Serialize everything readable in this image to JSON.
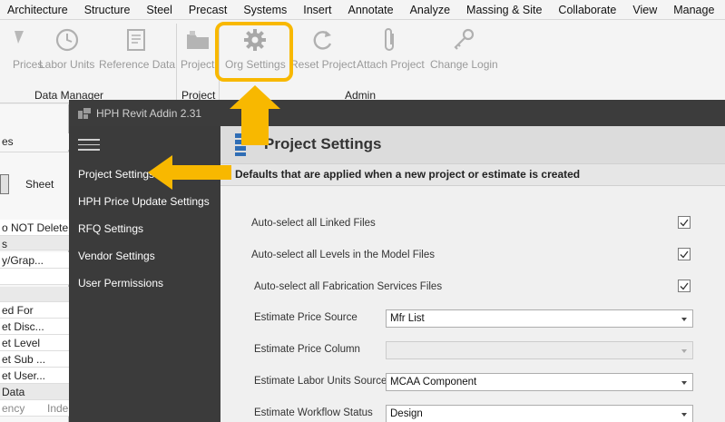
{
  "menubar": {
    "items": [
      "Architecture",
      "Structure",
      "Steel",
      "Precast",
      "Systems",
      "Insert",
      "Annotate",
      "Analyze",
      "Massing & Site",
      "Collaborate",
      "View",
      "Manage"
    ],
    "overflow": "˄"
  },
  "ribbon": {
    "buttons": [
      {
        "label": "Prices",
        "icon": "prices-icon"
      },
      {
        "label": "Labor Units",
        "icon": "clock-icon"
      },
      {
        "label": "Reference Data",
        "icon": "reference-data-icon"
      },
      {
        "label": "Project",
        "icon": "folder-icon"
      },
      {
        "label": "Org Settings",
        "icon": "gear-icon"
      },
      {
        "label": "Reset Project",
        "icon": "refresh-icon"
      },
      {
        "label": "Attach Project",
        "icon": "paperclip-icon"
      },
      {
        "label": "Change Login",
        "icon": "keys-icon"
      }
    ],
    "groups": [
      "Data Manager",
      "Project",
      "Admin"
    ]
  },
  "left_panel": {
    "rows": [
      "es",
      "Sheet",
      "o NOT Delete",
      "s",
      "y/Grap...",
      "",
      "ed For",
      "et Disc...",
      "et Level",
      "et Sub ...",
      "et User...",
      "Data",
      "ency",
      "Inde"
    ]
  },
  "dialog": {
    "title": "HPH Revit Addin 2.31",
    "nav": [
      "Project Settings",
      "HPH Price Update Settings",
      "RFQ Settings",
      "Vendor Settings",
      "User Permissions"
    ],
    "header_title": "Project Settings",
    "subheader": "Defaults that are applied when a new project or estimate is created",
    "checkbox_settings": [
      {
        "label": "Auto-select all Linked Files",
        "checked": true
      },
      {
        "label": "Auto-select all Levels in the Model Files",
        "checked": true
      },
      {
        "label": "Auto-select all Fabrication Services Files",
        "checked": true
      }
    ],
    "dropdown_settings": [
      {
        "label": "Estimate Price Source",
        "value": "Mfr List",
        "disabled": false
      },
      {
        "label": "Estimate Price Column",
        "value": "",
        "disabled": true
      },
      {
        "label": "Estimate Labor Units Source",
        "value": "MCAA Component",
        "disabled": false
      },
      {
        "label": "Estimate Workflow Status",
        "value": "Design",
        "disabled": false
      }
    ]
  },
  "colors": {
    "highlight": "#f8b800",
    "sidebar": "#3b3b3b",
    "titlebar": "#3c3c3c"
  }
}
